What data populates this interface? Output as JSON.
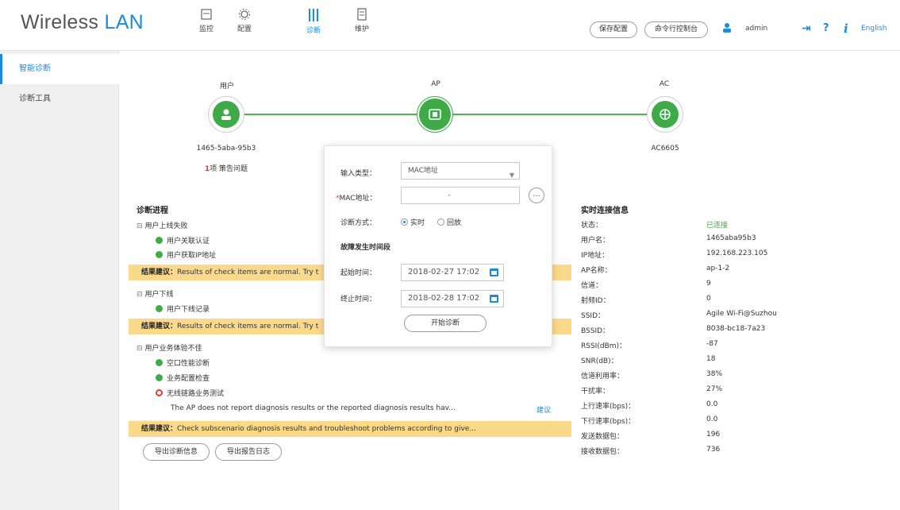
{
  "app": {
    "brand_main": "Wireless ",
    "brand_accent": "LAN"
  },
  "nav": [
    {
      "label": "监控",
      "icon": "monitor-icon"
    },
    {
      "label": "配置",
      "icon": "gear-icon"
    },
    {
      "label": "诊断",
      "icon": "diagnosis-icon"
    },
    {
      "label": "维护",
      "icon": "maintenance-icon"
    }
  ],
  "header": {
    "save_label": "保存配置",
    "cli_label": "命令行控制台",
    "user": "admin",
    "help": "?",
    "info": "i",
    "logout": "⇥",
    "language": "English"
  },
  "sidebar": {
    "items": [
      {
        "label": "智能诊断"
      },
      {
        "label": "诊断工具"
      }
    ]
  },
  "topology": {
    "user": {
      "label": "用户",
      "name": "1465-5aba-95b3",
      "count": "1",
      "count_suffix": "项 策告问题"
    },
    "ap": {
      "label": "AP"
    },
    "ac": {
      "label": "AC",
      "name": "AC6605"
    },
    "colors": {
      "node": "#3fab48",
      "line": "#4caf50"
    }
  },
  "diag": {
    "title": "诊断进程",
    "g1": "用户上线失败",
    "g1_items": [
      "用户关联认证",
      "用户获取IP地址"
    ],
    "banner_prefix": "结果建议：",
    "banner1": "Results of check items are normal. Try t",
    "g2": "用户下线",
    "g2_items": [
      "用户下线记录"
    ],
    "banner2": "Results of check items are normal. Try t",
    "g3": "用户业务体验不佳",
    "g3_items": [
      "空口性能诊断",
      "业务配置检查"
    ],
    "g3_fail": "无线链路业务测试",
    "fail_text": "The AP does not report diagnosis results or the reported diagnosis results hav...",
    "fail_link": "建议",
    "banner3": "Check subscenario diagnosis results and troubleshoot problems according to give...",
    "export_info": "导出诊断信息",
    "export_log": "导出报告日志"
  },
  "popup": {
    "input_type_label": "输入类型：",
    "input_type_value": "MAC地址",
    "mac_label": "MAC地址：",
    "mac_value": "-",
    "mac_more": "...",
    "mode_label": "诊断方式：",
    "mode_options": [
      "实时",
      "回放"
    ],
    "time_section": "故障发生时间段",
    "start_label": "起始时间：",
    "start_value": "2018-02-27 17:02",
    "end_label": "终止时间：",
    "end_value": "2018-02-28 17:02",
    "start_button": "开始诊断"
  },
  "info": {
    "title": "实时连接信息",
    "rows": [
      {
        "k": "状态：",
        "v": "已连接"
      },
      {
        "k": "用户名：",
        "v": "1465aba95b3"
      },
      {
        "k": "IP地址：",
        "v": "192.168.223.105"
      },
      {
        "k": "AP名称：",
        "v": "ap-1-2"
      },
      {
        "k": "信道：",
        "v": "9"
      },
      {
        "k": "射频ID：",
        "v": "0"
      },
      {
        "k": "SSID：",
        "v": "Agile Wi-Fi@Suzhou"
      },
      {
        "k": "BSSID：",
        "v": "8038-bc18-7a23"
      },
      {
        "k": "RSSI(dBm)：",
        "v": "-87"
      },
      {
        "k": "SNR(dB)：",
        "v": "18"
      },
      {
        "k": "信道利用率：",
        "v": "38%"
      },
      {
        "k": "干扰率：",
        "v": "27%"
      },
      {
        "k": "上行速率(bps)：",
        "v": "0.0"
      },
      {
        "k": "下行速率(bps)：",
        "v": "0.0"
      },
      {
        "k": "发送数据包：",
        "v": "196"
      },
      {
        "k": "接收数据包：",
        "v": "736"
      }
    ]
  }
}
